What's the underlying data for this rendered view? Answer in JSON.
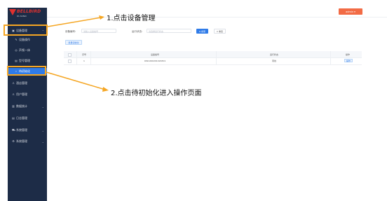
{
  "sidebar": {
    "brand": "BELLBIRD",
    "brand_sub": "PA SONIC",
    "items": [
      {
        "label": "设备管理",
        "icon": "device-icon",
        "expanded": true
      },
      {
        "label": "设备操作",
        "icon": "wrench-icon"
      },
      {
        "label": "声频一体",
        "icon": "location-icon"
      },
      {
        "label": "型号管理",
        "icon": "tag-icon"
      },
      {
        "label": "待初始化",
        "icon": "search-icon",
        "active": true
      },
      {
        "label": "酒店管理",
        "icon": "user-icon"
      },
      {
        "label": "用户管理",
        "icon": "user-icon"
      },
      {
        "label": "数据统计",
        "icon": "chart-icon"
      },
      {
        "label": "日志管理",
        "icon": "log-icon"
      },
      {
        "label": "系统管理",
        "icon": "cart-icon"
      },
      {
        "label": "系统管理",
        "icon": "gear-icon"
      }
    ]
  },
  "topbar": {
    "user_label": "admin ▾"
  },
  "filters": {
    "device_no_label": "设备编号:",
    "device_no_placeholder": "请输入设备编号",
    "status_label": "运行状态:",
    "status_placeholder": "请选择运行状态",
    "search_label": "Q 搜索",
    "reset_label": "C 重置"
  },
  "actions": {
    "init_label": "批量初始化"
  },
  "table": {
    "headers": [
      "序号",
      "设备编号",
      "运行状态",
      "操作"
    ],
    "rows": [
      {
        "index": "1",
        "device_no": "0091290291029301",
        "status": "离线",
        "action": "操作"
      }
    ]
  },
  "annotations": {
    "step1": "1.点击设备管理",
    "step2": "2.点击待初始化进入操作页面",
    "highlight_color": "#f5a623"
  }
}
